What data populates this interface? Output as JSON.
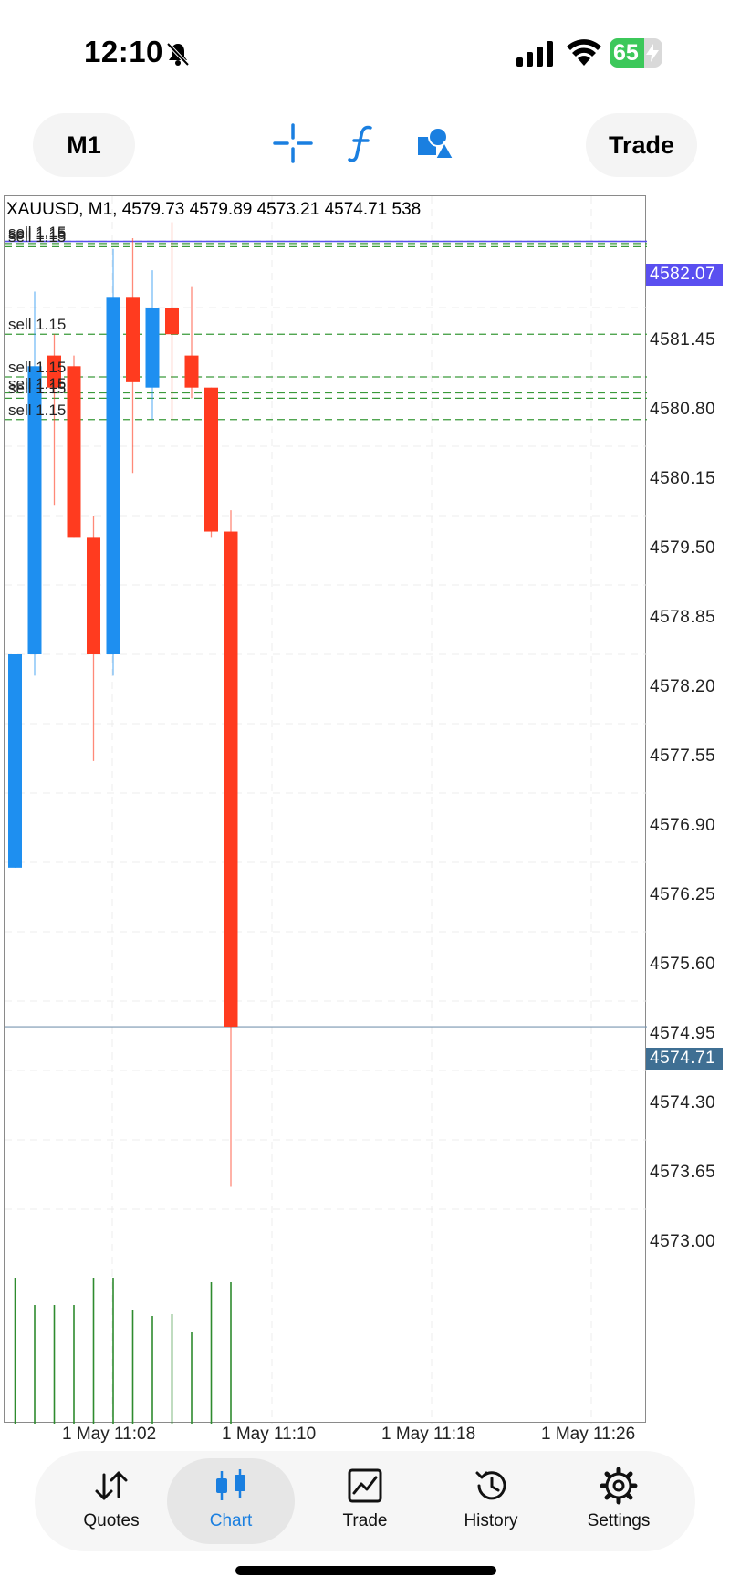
{
  "status_bar": {
    "time": "12:10",
    "battery": "65",
    "battery_level": 0.65,
    "icons": [
      "bell-muted-icon",
      "cellular-signal-icon",
      "wifi-icon",
      "battery-charging-icon"
    ]
  },
  "toolbar": {
    "timeframe": "M1",
    "trade_label": "Trade",
    "icons": [
      "crosshair-icon",
      "indicator-function-icon",
      "objects-shapes-icon"
    ]
  },
  "chart": {
    "symbol_info": "XAUUSD, M1, 4579.73 4579.89 4573.21 4574.71 538",
    "price_axis": [
      "4581.45",
      "4580.80",
      "4580.15",
      "4579.50",
      "4578.85",
      "4578.20",
      "4577.55",
      "4576.90",
      "4576.25",
      "4575.60",
      "4574.95",
      "4574.30",
      "4573.65",
      "4573.00"
    ],
    "top_price_tag": "4582.07",
    "current_price_tag": "4574.71",
    "time_axis": [
      "1 May 11:02",
      "1 May 11:10",
      "1 May 11:18",
      "1 May 11:26"
    ],
    "order_labels": [
      "sell 1.15",
      "sell 1.15",
      "sell 1.15",
      "sell 1.15",
      "sell 1.15",
      "sell 1.15",
      "sell 1.15",
      "sell 1.15"
    ],
    "colors": {
      "bull": "#1e8ff0",
      "bear": "#ff3b1f",
      "order_line": "#3a9a3a",
      "bid_line": "#7a96b0",
      "top_tag": "#5a4ff0",
      "bid_tag": "#3f6f93",
      "volume": "#2e8b2e"
    }
  },
  "chart_data": {
    "type": "candlestick",
    "symbol": "XAUUSD",
    "timeframe": "M1",
    "ohlc_header": {
      "open": 4579.73,
      "high": 4579.89,
      "low": 4573.21,
      "close": 4574.71,
      "volume": 538
    },
    "ylim": [
      4572.6,
      4582.4
    ],
    "candles": [
      {
        "open": 4576.2,
        "high": 4578.2,
        "low": 4576.2,
        "close": 4578.2
      },
      {
        "open": 4578.2,
        "high": 4581.6,
        "low": 4578.0,
        "close": 4580.9
      },
      {
        "open": 4581.0,
        "high": 4581.2,
        "low": 4579.6,
        "close": 4580.7
      },
      {
        "open": 4580.9,
        "high": 4581.0,
        "low": 4579.3,
        "close": 4579.3
      },
      {
        "open": 4579.3,
        "high": 4579.5,
        "low": 4577.2,
        "close": 4578.2
      },
      {
        "open": 4578.2,
        "high": 4582.0,
        "low": 4578.0,
        "close": 4581.55
      },
      {
        "open": 4581.55,
        "high": 4582.1,
        "low": 4579.9,
        "close": 4580.75
      },
      {
        "open": 4580.7,
        "high": 4581.8,
        "low": 4580.4,
        "close": 4581.45
      },
      {
        "open": 4581.45,
        "high": 4582.25,
        "low": 4580.4,
        "close": 4581.2
      },
      {
        "open": 4581.0,
        "high": 4581.65,
        "low": 4580.6,
        "close": 4580.7
      },
      {
        "open": 4580.7,
        "high": 4580.7,
        "low": 4579.3,
        "close": 4579.35
      },
      {
        "open": 4579.35,
        "high": 4579.55,
        "low": 4573.21,
        "close": 4574.71
      }
    ],
    "volumes": [
      0,
      0,
      0,
      0,
      0,
      0,
      0,
      0,
      0,
      0,
      0,
      538
    ],
    "volume_scale": [
      160,
      130,
      130,
      130,
      160,
      160,
      125,
      118,
      120,
      100,
      155,
      155
    ],
    "order_levels": [
      4582.07,
      4582.05,
      4582.02,
      4581.2,
      4580.8,
      4580.65,
      4580.6,
      4580.4
    ],
    "bid": 4574.71,
    "x_ticks": [
      "1 May 11:02",
      "1 May 11:10",
      "1 May 11:18",
      "1 May 11:26"
    ]
  },
  "nav": {
    "items": [
      {
        "label": "Quotes",
        "icon": "quotes-arrows-icon"
      },
      {
        "label": "Chart",
        "icon": "chart-candles-icon"
      },
      {
        "label": "Trade",
        "icon": "trade-chart-icon"
      },
      {
        "label": "History",
        "icon": "history-clock-icon"
      },
      {
        "label": "Settings",
        "icon": "settings-gear-icon"
      }
    ],
    "active": "Chart"
  }
}
